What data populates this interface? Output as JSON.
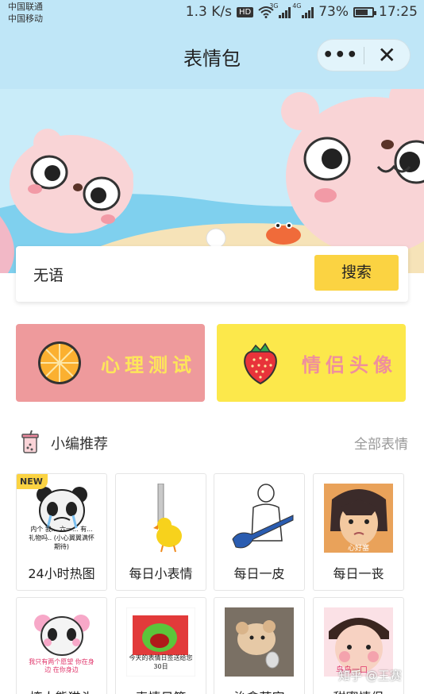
{
  "status_bar": {
    "carrier_1": "中国联通",
    "carrier_2": "中国移动",
    "speed": "1.3 K/s",
    "hd": "HD",
    "net_1": "3G",
    "net_2": "4G",
    "battery": "73%",
    "time": "17:25"
  },
  "header": {
    "title": "表情包",
    "more_icon": "more-dots-icon",
    "close_icon": "close-icon"
  },
  "banner": {
    "image": "bear-beach-banner"
  },
  "search": {
    "value": "无语",
    "button_label": "搜索",
    "button_color": "#fbd342"
  },
  "features": [
    {
      "label": "心理测试",
      "icon": "orange-slice-icon",
      "bg": "#ee9a9c"
    },
    {
      "label": "情侣头像",
      "icon": "strawberry-icon",
      "bg": "#fce84b"
    }
  ],
  "section": {
    "icon": "bubble-tea-icon",
    "title": "小编推荐",
    "see_all": "全部表情"
  },
  "grid": [
    {
      "label": "24小时热图",
      "badge": "NEW",
      "caption": "内个 我... 六一... 有... 礼物吗.. (小心翼翼满怀期待)"
    },
    {
      "label": "每日小表情"
    },
    {
      "label": "每日一皮"
    },
    {
      "label": "每日一丧",
      "caption": "心好塞"
    },
    {
      "label": "撩人熊猫头",
      "caption": "我只有两个愿望 你在身边 在你身边"
    },
    {
      "label": "表情日签",
      "caption": "今天的表情日签送给您 30日"
    },
    {
      "label": "治愈萌宠"
    },
    {
      "label": "甜蜜情侣",
      "caption": "鸟鸟一口"
    }
  ],
  "watermark": "知乎 @王赛",
  "colors": {
    "accent": "#fbd342",
    "header_bg": "#bfe6f7"
  }
}
